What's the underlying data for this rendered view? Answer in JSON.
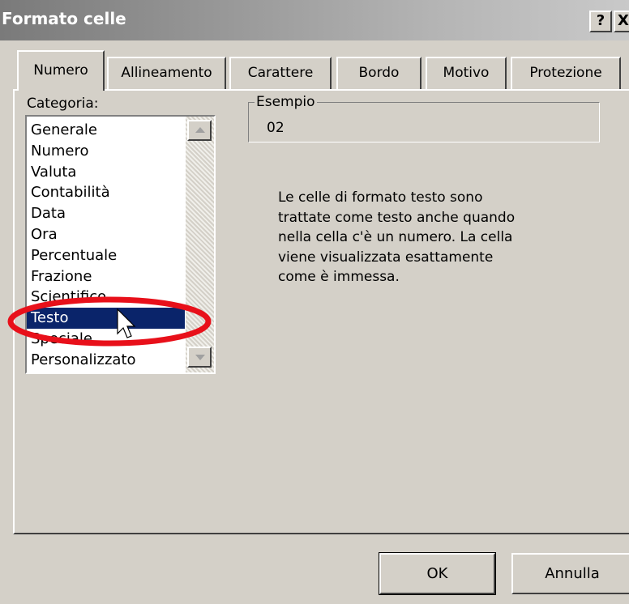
{
  "window": {
    "title": "Formato celle",
    "help_label": "?",
    "close_label": "X"
  },
  "tabs": [
    {
      "label": "Numero",
      "active": true
    },
    {
      "label": "Allineamento",
      "active": false
    },
    {
      "label": "Carattere",
      "active": false
    },
    {
      "label": "Bordo",
      "active": false
    },
    {
      "label": "Motivo",
      "active": false
    },
    {
      "label": "Protezione",
      "active": false
    }
  ],
  "category": {
    "label": "Categoria:",
    "items": [
      "Generale",
      "Numero",
      "Valuta",
      "Contabilità",
      "Data",
      "Ora",
      "Percentuale",
      "Frazione",
      "Scientifico",
      "Testo",
      "Speciale",
      "Personalizzato"
    ],
    "selected": "Testo"
  },
  "sample": {
    "legend": "Esempio",
    "value": "02"
  },
  "description_lines": [
    "Le celle di formato testo sono",
    "trattate come testo anche quando",
    "nella cella c'è un numero. La cella",
    "viene visualizzata esattamente",
    "come è immessa."
  ],
  "buttons": {
    "ok": "OK",
    "cancel": "Annulla"
  },
  "colors": {
    "dialog_bg": "#d4d0c8",
    "selection": "#0a246a",
    "annotation": "#e8101a"
  }
}
